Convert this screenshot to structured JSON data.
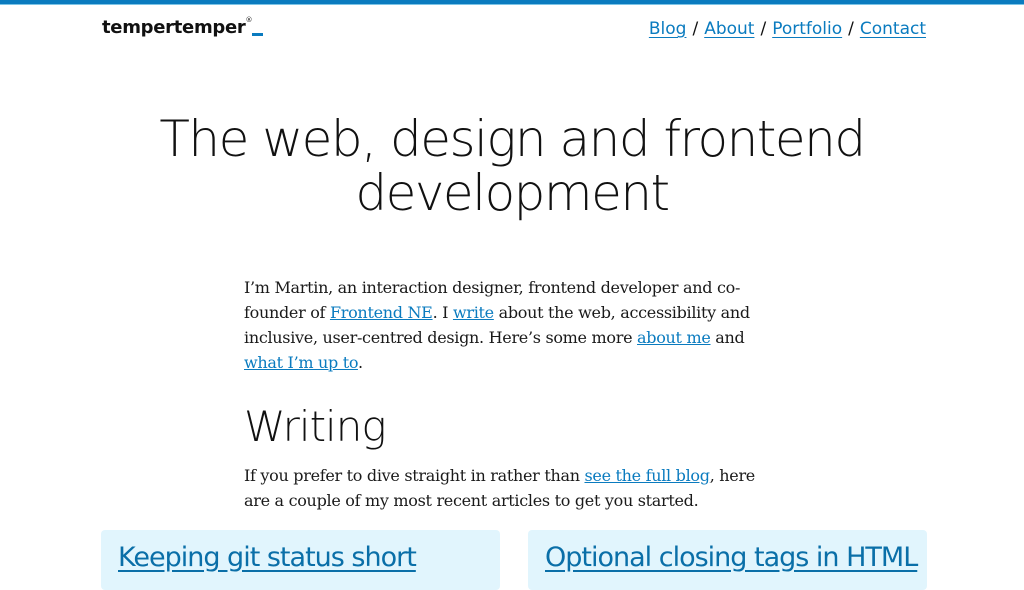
{
  "header": {
    "logo_text": "tempertemper",
    "logo_mark": "®",
    "nav": [
      {
        "label": "Blog"
      },
      {
        "label": "About"
      },
      {
        "label": "Portfolio"
      },
      {
        "label": "Contact"
      }
    ],
    "separator": "/"
  },
  "hero": {
    "line1": "The web, design and frontend",
    "line2": "development"
  },
  "intro": {
    "t1": "I’m Martin, an interaction designer, frontend developer and co-founder of ",
    "link1": "Frontend NE",
    "t2": ". I ",
    "link2": "write",
    "t3": " about the web, accessibility and inclusive, user-centred design. Here’s some more ",
    "link3": "about me",
    "t4": " and ",
    "link4": "what I’m up to",
    "t5": "."
  },
  "writing": {
    "heading": "Writing",
    "t1": "If you prefer to dive straight in rather than ",
    "link": "see the full blog",
    "t2": ", here are a couple of my most recent articles to get you started.",
    "articles": [
      {
        "title": "Keeping git status short"
      },
      {
        "title": "Optional closing tags in HTML"
      }
    ]
  },
  "colors": {
    "accent": "#0a7bbf",
    "card_bg": "#e1f5fd",
    "text": "#111111"
  }
}
